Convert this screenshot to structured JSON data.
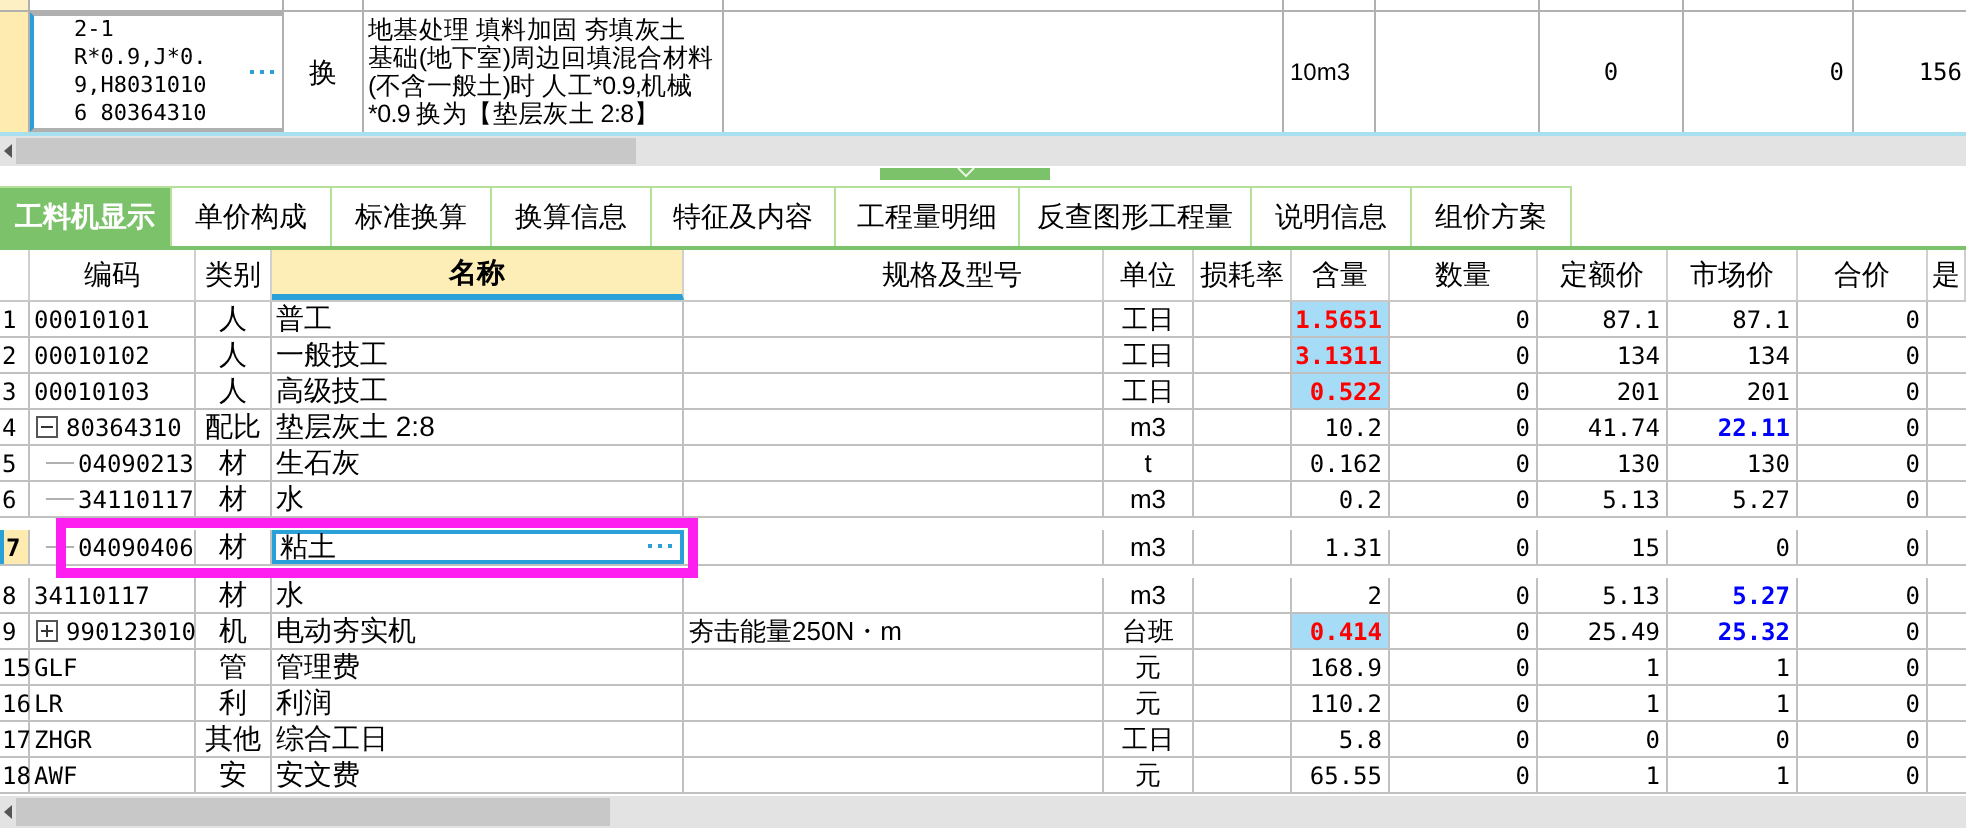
{
  "top_row": {
    "selected": true,
    "code_lines": [
      "2-1",
      "R*0.9,J*0.",
      "9,H8031010",
      "6 80364310"
    ],
    "type": "换",
    "name_lines": [
      "地基处理 填料加固 夯填灰土",
      "基础(地下室)周边回填混合材料",
      "(不含一般土)时 人工*0.9,机械",
      "*0.9  换为【垫层灰土 2:8】"
    ],
    "unit": "10m3",
    "column_7": "0",
    "column_8": "0",
    "column_9": "156"
  },
  "tabs": [
    {
      "label": "工料机显示",
      "selected": true
    },
    {
      "label": "单价构成",
      "selected": false
    },
    {
      "label": "标准换算",
      "selected": false
    },
    {
      "label": "换算信息",
      "selected": false
    },
    {
      "label": "特征及内容",
      "selected": false
    },
    {
      "label": "工程量明细",
      "selected": false
    },
    {
      "label": "反查图形工程量",
      "selected": false
    },
    {
      "label": "说明信息",
      "selected": false
    },
    {
      "label": "组价方案",
      "selected": false
    }
  ],
  "columns": [
    {
      "label": "编码",
      "sorted": false
    },
    {
      "label": "类别",
      "sorted": false
    },
    {
      "label": "名称",
      "sorted": true
    },
    {
      "label": "规格及型号",
      "sorted": false
    },
    {
      "label": "单位",
      "sorted": false
    },
    {
      "label": "损耗率",
      "sorted": false
    },
    {
      "label": "含量",
      "sorted": false
    },
    {
      "label": "数量",
      "sorted": false
    },
    {
      "label": "定额价",
      "sorted": false
    },
    {
      "label": "市场价",
      "sorted": false
    },
    {
      "label": "合价",
      "sorted": false
    },
    {
      "label": "是",
      "sorted": false
    }
  ],
  "rows": [
    {
      "no": "1",
      "code": "00010101",
      "type": "人",
      "name": "普工",
      "unit": "工日",
      "content": "1.5651",
      "content_modified": true,
      "qty": "0",
      "quota_price": "87.1",
      "market_price": "87.1",
      "price_changed": false,
      "total": "0",
      "selected": false
    },
    {
      "no": "2",
      "code": "00010102",
      "type": "人",
      "name": "一般技工",
      "unit": "工日",
      "content": "3.1311",
      "content_modified": true,
      "qty": "0",
      "quota_price": "134",
      "market_price": "134",
      "price_changed": false,
      "total": "0",
      "selected": false
    },
    {
      "no": "3",
      "code": "00010103",
      "type": "人",
      "name": "高级技工",
      "unit": "工日",
      "content": "0.522",
      "content_modified": true,
      "qty": "0",
      "quota_price": "201",
      "market_price": "201",
      "price_changed": false,
      "total": "0",
      "selected": false
    },
    {
      "no": "4",
      "code": "80364310",
      "type": "配比",
      "name": "垫层灰土 2:8",
      "unit": "m3",
      "content": "10.2",
      "content_modified": false,
      "qty": "0",
      "quota_price": "41.74",
      "market_price": "22.11",
      "price_changed": true,
      "total": "0",
      "selected": false,
      "expanded": true,
      "children": [
        {
          "no": "5",
          "code": "04090213",
          "type": "材",
          "name": "生石灰",
          "unit": "t",
          "content": "0.162",
          "content_modified": false,
          "qty": "0",
          "quota_price": "130",
          "market_price": "130",
          "price_changed": false,
          "total": "0",
          "selected": false
        },
        {
          "no": "6",
          "code": "34110117",
          "type": "材",
          "name": "水",
          "unit": "m3",
          "content": "0.2",
          "content_modified": false,
          "qty": "0",
          "quota_price": "5.13",
          "market_price": "5.27",
          "price_changed": false,
          "total": "0",
          "selected": false
        },
        {
          "no": "7",
          "code": "04090406",
          "type": "材",
          "name": "粘土",
          "unit": "m3",
          "content": "1.31",
          "content_modified": false,
          "qty": "0",
          "quota_price": "15",
          "market_price": "0",
          "price_changed": false,
          "total": "0",
          "selected": true
        }
      ]
    },
    {
      "no": "8",
      "code": "34110117",
      "type": "材",
      "name": "水",
      "unit": "m3",
      "content": "2",
      "content_modified": false,
      "qty": "0",
      "quota_price": "5.13",
      "market_price": "5.27",
      "price_changed": true,
      "total": "0",
      "selected": false
    },
    {
      "no": "9",
      "code": "990123010",
      "type": "机",
      "name": "电动夯实机",
      "spec": "夯击能量250N・m",
      "unit": "台班",
      "content": "0.414",
      "content_modified": true,
      "qty": "0",
      "quota_price": "25.49",
      "market_price": "25.32",
      "price_changed": true,
      "total": "0",
      "selected": false,
      "expanded": false
    },
    {
      "no": "15",
      "code": "GLF",
      "type": "管",
      "name": "管理费",
      "unit": "元",
      "content": "168.9",
      "content_modified": false,
      "qty": "0",
      "quota_price": "1",
      "market_price": "1",
      "price_changed": false,
      "total": "0",
      "selected": false
    },
    {
      "no": "16",
      "code": "LR",
      "type": "利",
      "name": "利润",
      "unit": "元",
      "content": "110.2",
      "content_modified": false,
      "qty": "0",
      "quota_price": "1",
      "market_price": "1",
      "price_changed": false,
      "total": "0",
      "selected": false
    },
    {
      "no": "17",
      "code": "ZHGR",
      "type": "其他",
      "name": "综合工日",
      "unit": "工日",
      "content": "5.8",
      "content_modified": false,
      "qty": "0",
      "quota_price": "0",
      "market_price": "0",
      "price_changed": false,
      "total": "0",
      "selected": false
    },
    {
      "no": "18",
      "code": "AWF",
      "type": "安",
      "name": "安文费",
      "unit": "元",
      "content": "65.55",
      "content_modified": false,
      "qty": "0",
      "quota_price": "1",
      "market_price": "1",
      "price_changed": false,
      "total": "0",
      "selected": false
    }
  ]
}
